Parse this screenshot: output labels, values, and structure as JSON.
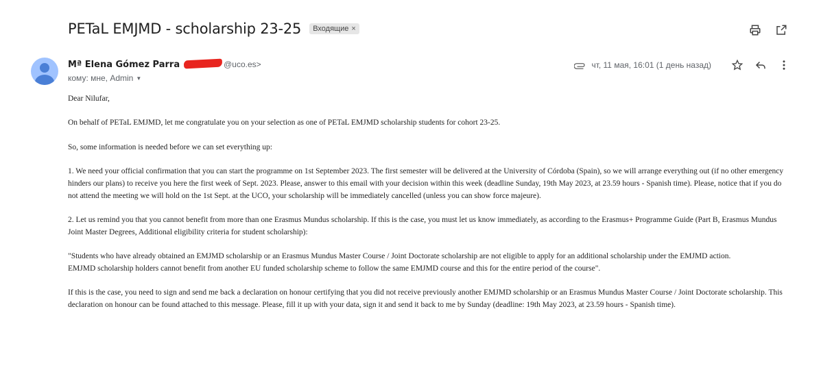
{
  "email": {
    "subject": "PETaL EMJMD - scholarship 23-25",
    "label": "Входящие",
    "label_close": "×",
    "sender_name": "Mª Elena Gómez Parra",
    "sender_email_suffix": "@uco.es>",
    "recipients": "кому: мне, Admin",
    "date": "чт, 11 мая, 16:01 (1 день назад)"
  },
  "icons": {
    "print": "print-icon",
    "open_new": "open-in-new-window-icon",
    "attachment": "attachment-icon",
    "star": "star-icon",
    "reply": "reply-icon",
    "more": "more-vertical-icon",
    "avatar": "avatar-person-icon"
  },
  "body": {
    "p1": "Dear Nilufar,",
    "p2": "On behalf of PETaL EMJMD, let me congratulate you on your selection as one of PETaL EMJMD scholarship students for cohort 23-25.",
    "p3": "So, some information is needed before we can set everything up:",
    "p4": "1. We need your official confirmation that you can start the programme on 1st September 2023. The first semester will be delivered at the University of Córdoba (Spain), so we will arrange everything out (if no other emergency hinders our plans) to receive you here the first week of Sept. 2023. Please, answer to this email with your decision within this week (deadline Sunday, 19th May 2023, at 23.59 hours - Spanish time). Please, notice that if you do not attend the meeting we will hold on the 1st Sept. at the UCO, your scholarship will be immediately cancelled (unless you can show force majeure).",
    "p5": "2. Let us remind you that you cannot benefit from more than one Erasmus Mundus scholarship. If this is the case, you must let us know immediately, as according to the Erasmus+ Programme Guide (Part B, Erasmus Mundus Joint Master Degrees, Additional eligibility criteria for student scholarship):",
    "p6_line1": "\"Students who have already obtained an EMJMD scholarship or an Erasmus Mundus Master Course / Joint Doctorate scholarship are not eligible to apply for an additional scholarship under the EMJMD action.",
    "p6_line2": "EMJMD scholarship holders cannot benefit from another EU funded scholarship scheme to follow the same EMJMD course and this for the entire period of the course\".",
    "p7": "If this is the case, you need to sign and send me back a declaration on honour certifying that you did not receive previously another EMJMD scholarship or an Erasmus Mundus Master Course / Joint Doctorate scholarship. This declaration on honour can be found attached to this message. Please, fill it up with your data, sign it and send it back to me by Sunday (deadline: 19th May 2023, at 23.59 hours - Spanish time)."
  }
}
